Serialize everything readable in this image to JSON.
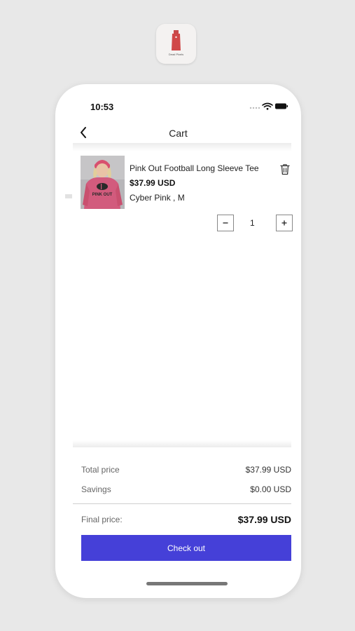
{
  "app_icon": {
    "brand": "Dead Pixels"
  },
  "status_bar": {
    "time": "10:53"
  },
  "header": {
    "title": "Cart"
  },
  "cart": {
    "items": [
      {
        "name": "Pink Out Football Long Sleeve Tee",
        "price": "$37.99 USD",
        "variant": "Cyber Pink , M",
        "quantity": "1",
        "image_text": "PINK OUT"
      }
    ]
  },
  "summary": {
    "total_label": "Total price",
    "total_value": "$37.99 USD",
    "savings_label": "Savings",
    "savings_value": "$0.00 USD",
    "final_label": "Final price:",
    "final_value": "$37.99 USD"
  },
  "checkout": {
    "label": "Check out"
  },
  "colors": {
    "accent": "#4540d8",
    "shirt": "#d25b7d",
    "background": "#e8e8e8"
  }
}
